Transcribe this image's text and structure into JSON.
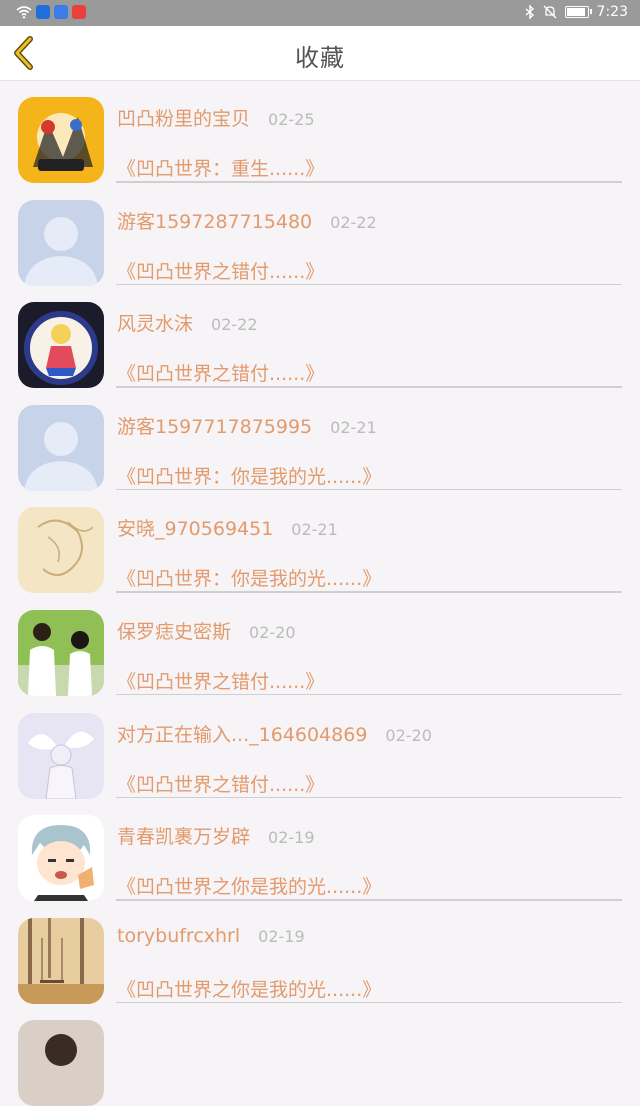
{
  "status_bar": {
    "time": "7:23"
  },
  "header": {
    "title": "收藏"
  },
  "favorites": [
    {
      "name": "凹凸粉里的宝贝",
      "date": "02-25",
      "book": "《凹凸世界：重生......》",
      "avatar": "game-art-avatar"
    },
    {
      "name": "游客1597287715480",
      "date": "02-22",
      "book": "《凹凸世界之错付......》",
      "avatar": "default-person-avatar"
    },
    {
      "name": "风灵水沫",
      "date": "02-22",
      "book": "《凹凸世界之错付......》",
      "avatar": "anime-girl-avatar"
    },
    {
      "name": "游客1597717875995",
      "date": "02-21",
      "book": "《凹凸世界：你是我的光......》",
      "avatar": "default-person-avatar"
    },
    {
      "name": "安晓_970569451",
      "date": "02-21",
      "book": "《凹凸世界：你是我的光......》",
      "avatar": "sketch-avatar"
    },
    {
      "name": "保罗痣史密斯",
      "date": "02-20",
      "book": "《凹凸世界之错付......》",
      "avatar": "couple-photo-avatar"
    },
    {
      "name": "对方正在输入..._164604869",
      "date": "02-20",
      "book": "《凹凸世界之错付......》",
      "avatar": "angel-wings-avatar"
    },
    {
      "name": "青春凯裹万岁辟",
      "date": "02-19",
      "book": "《凹凸世界之你是我的光......》",
      "avatar": "anime-boy-avatar"
    },
    {
      "name": "torybufrcxhrl",
      "date": "02-19",
      "book": "《凹凸世界之你是我的光......》",
      "avatar": "autumn-swing-avatar"
    }
  ]
}
